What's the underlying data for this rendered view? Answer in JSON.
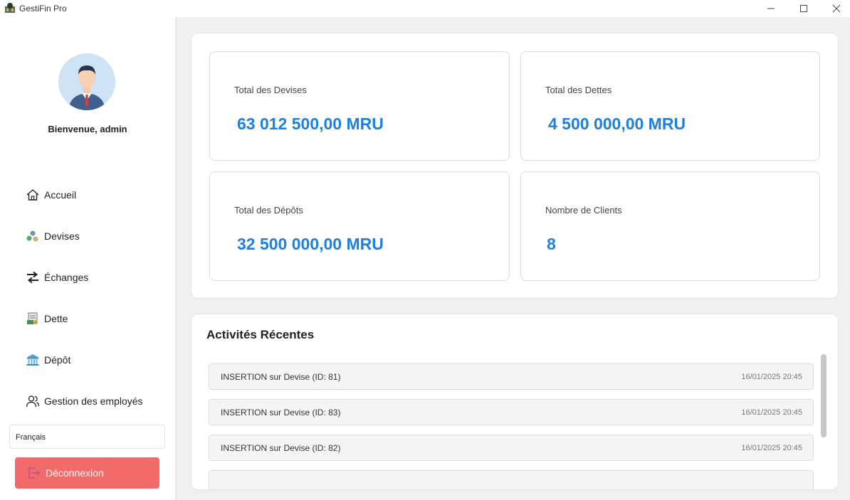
{
  "window": {
    "title": "GestiFin Pro",
    "controls": {
      "minimize": "—",
      "maximize": "☐",
      "close": "✕"
    }
  },
  "sidebar": {
    "welcome": "Bienvenue, admin",
    "nav": [
      {
        "label": "Accueil",
        "icon": "home-icon"
      },
      {
        "label": "Devises",
        "icon": "currency-icon"
      },
      {
        "label": "Échanges",
        "icon": "exchange-arrows-icon"
      },
      {
        "label": "Dette",
        "icon": "debt-document-icon"
      },
      {
        "label": "Dépôt",
        "icon": "bank-icon"
      },
      {
        "label": "Gestion des employés",
        "icon": "users-icon"
      }
    ],
    "language": "Français",
    "logout": "Déconnexion"
  },
  "stats": [
    {
      "label": "Total des Devises",
      "value": "63 012 500,00 MRU"
    },
    {
      "label": "Total des Dettes",
      "value": "4 500 000,00 MRU"
    },
    {
      "label": "Total des Dépôts",
      "value": "32 500 000,00 MRU"
    },
    {
      "label": "Nombre de Clients",
      "value": "8"
    }
  ],
  "activities": {
    "title": "Activités Récentes",
    "items": [
      {
        "text": "INSERTION sur Devise (ID: 81)",
        "time": "16/01/2025 20:45"
      },
      {
        "text": "INSERTION sur Devise (ID: 83)",
        "time": "16/01/2025 20:45"
      },
      {
        "text": "INSERTION sur Devise (ID: 82)",
        "time": "16/01/2025 20:45"
      },
      {
        "text": "",
        "time": ""
      }
    ]
  },
  "colors": {
    "accent": "#1e7fe0",
    "logout": "#f36a6a",
    "background": "#f0f0f0"
  }
}
